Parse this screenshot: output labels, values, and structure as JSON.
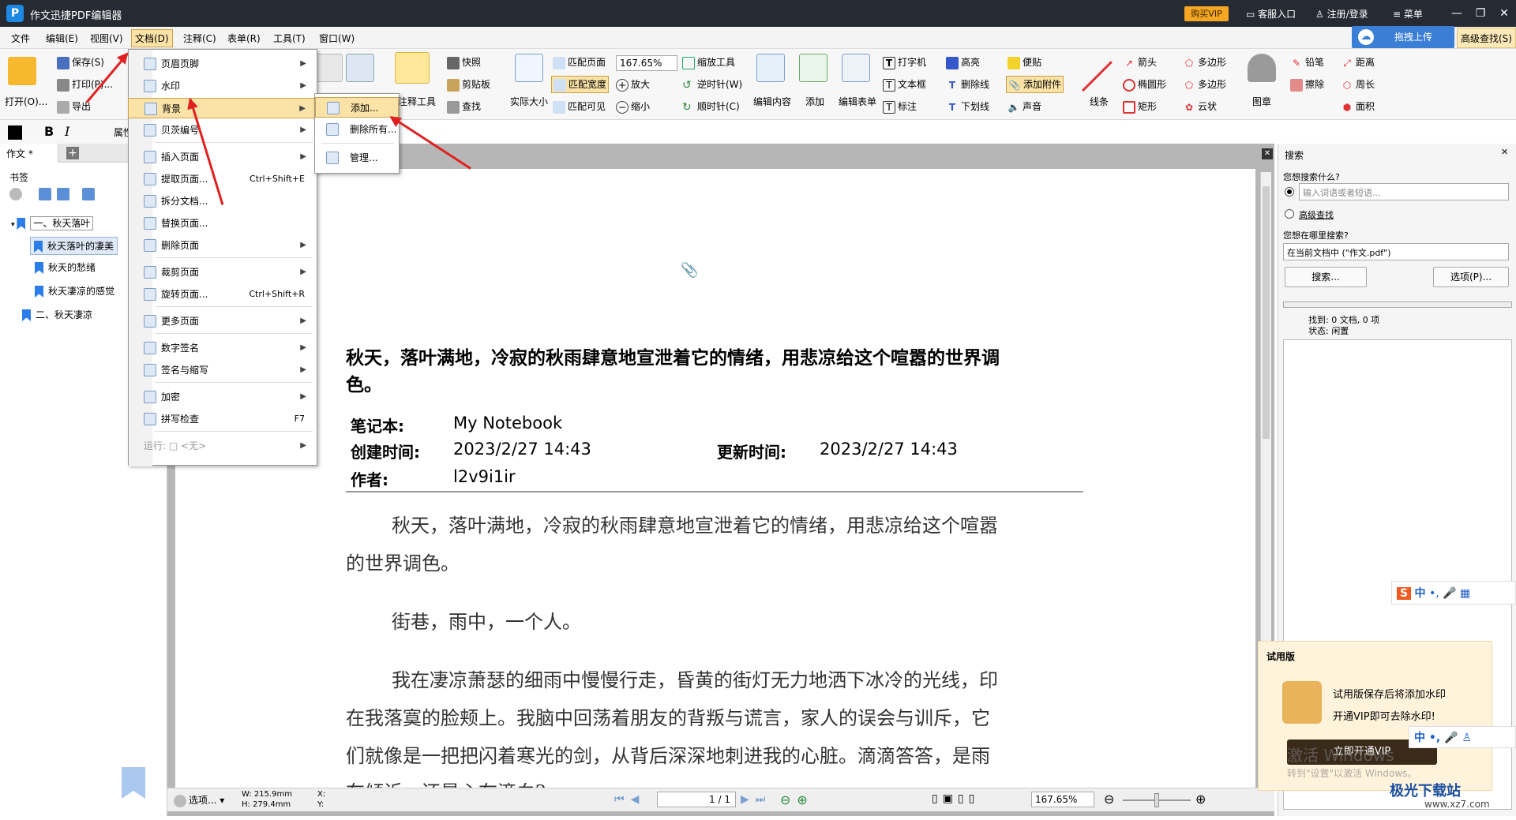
{
  "app": {
    "title": "作文迅捷PDF编辑器",
    "buy_vip": "购买VIP",
    "service": "客服入口",
    "login": "注册/登录",
    "menu": "菜单"
  },
  "menubar": {
    "items": [
      "文件",
      "编辑(E)",
      "视图(V)",
      "文档(D)",
      "注释(C)",
      "表单(R)",
      "工具(T)",
      "窗口(W)"
    ],
    "upload": "拖拽上传",
    "advanced": "高级查找(S)"
  },
  "toolbar": {
    "open": "打开(O)...",
    "save": "保存(S)",
    "print": "打印(P)...",
    "export": "导出",
    "annot_tool": "注释工具",
    "snapshot": "快照",
    "clipboard": "剪贴板",
    "find": "查找",
    "actual_size": "实际大小",
    "fit_page": "匹配页面",
    "fit_width": "匹配宽度",
    "fit_visible": "匹配可见",
    "zoom": "167.65%",
    "zoom_in": "放大",
    "zoom_out": "缩小",
    "zoom_tool": "缩放工具",
    "ccw": "逆时针(W)",
    "cw": "顺时针(C)",
    "edit_content": "编辑内容",
    "add": "添加",
    "edit_form": "编辑表单",
    "typewriter": "打字机",
    "textbox": "文本框",
    "callout": "标注",
    "highlight": "高亮",
    "strikeout": "删除线",
    "underline": "下划线",
    "sticky": "便贴",
    "attach": "添加附件",
    "sound": "声音",
    "line": "线条",
    "arrow": "箭头",
    "ellipse": "椭圆形",
    "rect": "矩形",
    "polygon": "多边形",
    "polyline": "多边形",
    "cloud": "云状",
    "stamp": "图章",
    "pencil": "铅笔",
    "eraser": "擦除",
    "distance": "距离",
    "perimeter": "周长",
    "area": "面积",
    "properties": "属性"
  },
  "leftpanel": {
    "tab": "作文 *",
    "bookmarks_title": "书签",
    "items": [
      "一、秋天落叶",
      "秋天落叶的凄美",
      "秋天的愁绪",
      "秋天凄凉的感觉",
      "二、秋天凄凉"
    ]
  },
  "docmenu": {
    "items": [
      {
        "label": "页眉页脚",
        "shortcut": "",
        "sub": true
      },
      {
        "label": "水印",
        "shortcut": "",
        "sub": true
      },
      {
        "label": "背景",
        "shortcut": "",
        "sub": true
      },
      {
        "label": "贝茨编号",
        "shortcut": "",
        "sub": true
      },
      {
        "label": "插入页面",
        "shortcut": "",
        "sub": true
      },
      {
        "label": "提取页面...",
        "shortcut": "Ctrl+Shift+E",
        "sub": false
      },
      {
        "label": "拆分文档...",
        "shortcut": "",
        "sub": false
      },
      {
        "label": "替换页面...",
        "shortcut": "",
        "sub": false
      },
      {
        "label": "删除页面",
        "shortcut": "",
        "sub": true
      },
      {
        "label": "裁剪页面",
        "shortcut": "",
        "sub": true
      },
      {
        "label": "旋转页面...",
        "shortcut": "Ctrl+Shift+R",
        "sub": false
      },
      {
        "label": "更多页面",
        "shortcut": "",
        "sub": true
      },
      {
        "label": "数字签名",
        "shortcut": "",
        "sub": true
      },
      {
        "label": "签名与缩写",
        "shortcut": "",
        "sub": true
      },
      {
        "label": "加密",
        "shortcut": "",
        "sub": true
      },
      {
        "label": "拼写检查",
        "shortcut": "F7",
        "sub": false
      },
      {
        "label": "运行: □ <无>",
        "shortcut": "",
        "sub": true
      }
    ]
  },
  "submenu": {
    "items": [
      "添加...",
      "删除所有...",
      "管理..."
    ]
  },
  "document": {
    "heading": "秋天，落叶满地，冷寂的秋雨肆意地宣泄着它的情绪，用悲凉给这个喧嚣的世界调",
    "heading2": "色。",
    "notebook_label": "笔记本:",
    "notebook": "My Notebook",
    "created_label": "创建时间:",
    "created": "2023/2/27 14:43",
    "updated_label": "更新时间:",
    "updated": "2023/2/27 14:43",
    "author_label": "作者:",
    "author": "l2v9i1ir",
    "p1a": "秋天，落叶满地，冷寂的秋雨肆意地宣泄着它的情绪，用悲凉给这个喧嚣",
    "p1b": "的世界调色。",
    "p2": "街巷，雨中，一个人。",
    "p3a": "我在凄凉萧瑟的细雨中慢慢行走，昏黄的街灯无力地洒下冰冷的光线，印",
    "p3b": "在我落寞的脸颊上。我脑中回荡着朋友的背叛与谎言，家人的误会与训斥，它",
    "p3c": "们就像是一把把闪着寒光的剑，从背后深深地刺进我的心脏。滴滴答答，是雨",
    "p3d": "在倾诉，还是心在滴血?"
  },
  "statusbar": {
    "select": "选项...",
    "width": "W: 215.9mm",
    "height": "H: 279.4mm",
    "x": "X:",
    "y": "Y:",
    "page": "1 / 1",
    "zoom": "167.65%"
  },
  "search": {
    "title": "搜索",
    "what": "您想搜索什么?",
    "placeholder": "输入词语或者短语...",
    "advanced": "高级查找",
    "where": "您想在哪里搜索?",
    "scope": "在当前文档中 (\"作文.pdf\")",
    "search_btn": "搜索...",
    "options_btn": "选项(P)...",
    "found": "找到: 0 文档, 0 项",
    "status": "状态: 闲置"
  },
  "trial": {
    "title": "试用版",
    "line1": "试用版保存后将添加水印",
    "line2": "开通VIP即可去除水印!",
    "btn": "立即开通VIP",
    "watermark": "激活 Windows",
    "watermark2": "转到\"设置\"以激活 Windows。"
  },
  "ime": {
    "label": "中"
  },
  "site": {
    "name": "极光下载站",
    "url": "www.xz7.com"
  }
}
